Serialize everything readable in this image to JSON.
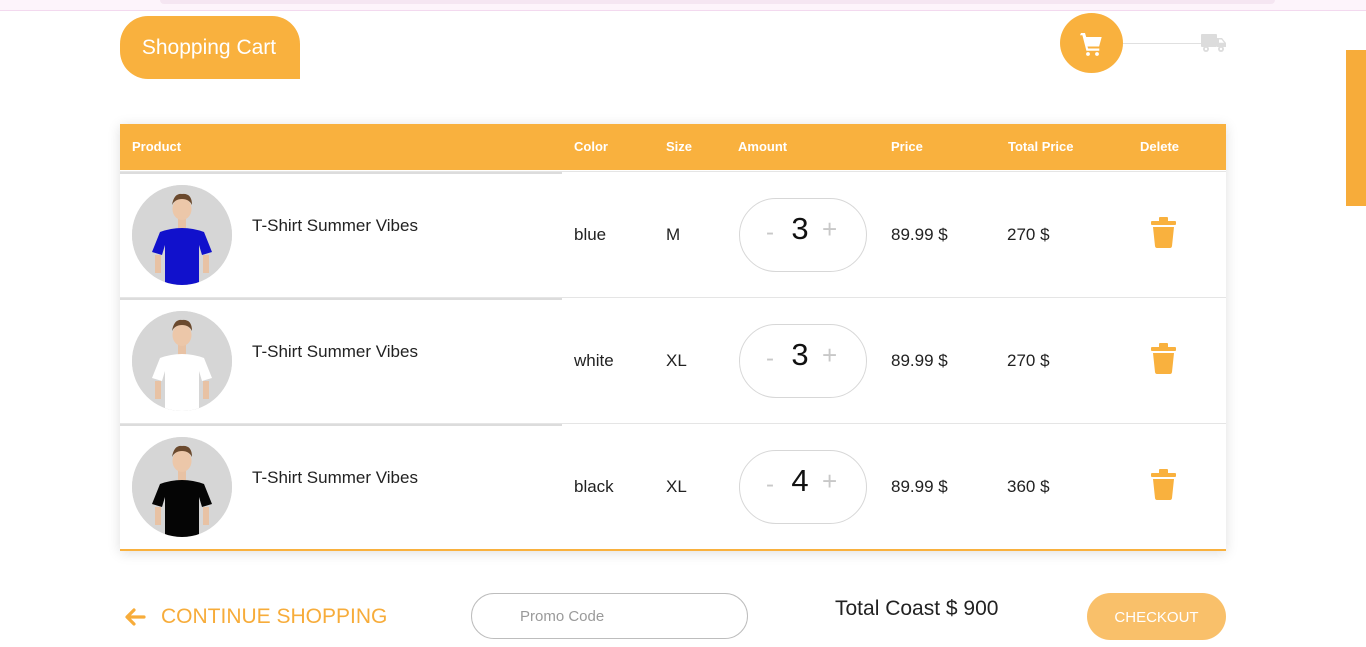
{
  "header": {
    "title": "Shopping Cart"
  },
  "table": {
    "columns": [
      "Product",
      "Color",
      "Size",
      "Amount",
      "Price",
      "Total Price",
      "Delete"
    ],
    "rows": [
      {
        "name": "T-Shirt Summer Vibes",
        "color": "blue",
        "size": "M",
        "amount": "3",
        "price": "89.99 $",
        "total": "270 $",
        "shirt_color": "#1111cc"
      },
      {
        "name": "T-Shirt Summer Vibes",
        "color": "white",
        "size": "XL",
        "amount": "3",
        "price": "89.99 $",
        "total": "270 $",
        "shirt_color": "#ffffff"
      },
      {
        "name": "T-Shirt Summer Vibes",
        "color": "black",
        "size": "XL",
        "amount": "4",
        "price": "89.99 $",
        "total": "360 $",
        "shirt_color": "#050505"
      }
    ],
    "stepper_minus": "-",
    "stepper_plus": "+"
  },
  "footer": {
    "continue_label": "CONTINUE SHOPPING",
    "promo_placeholder": "Promo Code",
    "total_label": "Total Coast $ 900",
    "checkout_label": "CHECKOUT"
  },
  "colors": {
    "accent": "#f9b13e",
    "checkout_bg": "#f9c06a"
  },
  "icons": {
    "cart": "cart-icon",
    "truck": "truck-icon",
    "trash": "trash-icon",
    "arrow": "arrow-left-icon"
  }
}
